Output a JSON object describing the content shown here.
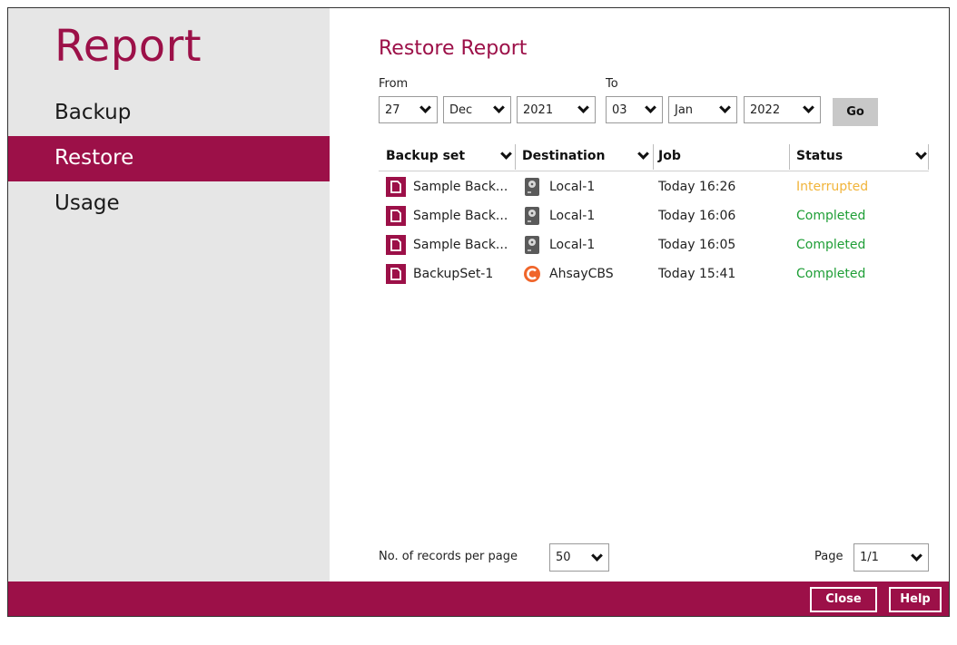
{
  "sidebar": {
    "title": "Report",
    "items": [
      {
        "label": "Backup"
      },
      {
        "label": "Restore"
      },
      {
        "label": "Usage"
      }
    ]
  },
  "main": {
    "title": "Restore Report",
    "from_label": "From",
    "to_label": "To",
    "from": {
      "day": "27",
      "month": "Dec",
      "year": "2021"
    },
    "to": {
      "day": "03",
      "month": "Jan",
      "year": "2022"
    },
    "go_label": "Go",
    "columns": [
      "Backup set",
      "Destination",
      "Job",
      "Status"
    ],
    "rows": [
      {
        "backup_set": "Sample Back...",
        "destination": "Local-1",
        "dest_icon": "local-drive-icon",
        "job": "Today 16:26",
        "status": "Interrupted"
      },
      {
        "backup_set": "Sample Back...",
        "destination": "Local-1",
        "dest_icon": "local-drive-icon",
        "job": "Today 16:06",
        "status": "Completed"
      },
      {
        "backup_set": "Sample Back...",
        "destination": "Local-1",
        "dest_icon": "local-drive-icon",
        "job": "Today 16:05",
        "status": "Completed"
      },
      {
        "backup_set": "BackupSet-1",
        "destination": "AhsayCBS",
        "dest_icon": "ahsay-cbs-icon",
        "job": "Today 15:41",
        "status": "Completed"
      }
    ],
    "records_per_page_label": "No. of records per page",
    "records_per_page": "50",
    "page_label": "Page",
    "page_value": "1/1"
  },
  "footer": {
    "close_label": "Close",
    "help_label": "Help"
  },
  "colors": {
    "brand": "#9c1048",
    "sidebar_bg": "#e6e6e6",
    "interrupted": "#f1b43a",
    "completed": "#1e9e36"
  }
}
